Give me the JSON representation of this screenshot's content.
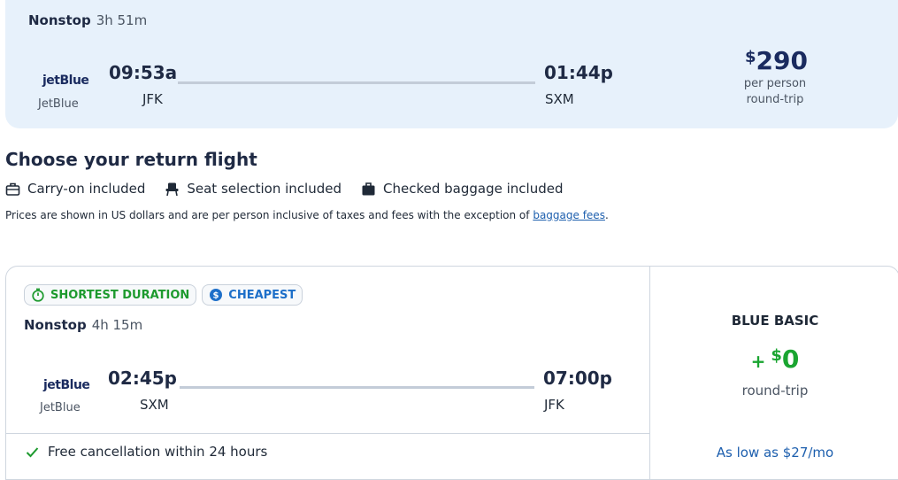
{
  "outbound": {
    "stops": "Nonstop",
    "duration": "3h 51m",
    "airline_logo": "jetBlue",
    "airline_name": "JetBlue",
    "depart_time": "09:53a",
    "depart_code": "JFK",
    "arrive_time": "01:44p",
    "arrive_code": "SXM",
    "price_currency": "$",
    "price_amount": "290",
    "price_note1": "per person",
    "price_note2": "round-trip"
  },
  "section": {
    "title": "Choose your return flight",
    "amenities": {
      "carry_on": "Carry-on included",
      "seat": "Seat selection included",
      "checked": "Checked baggage included"
    },
    "disclaimer": "Prices are shown in US dollars and are per person inclusive of taxes and fees with the exception of",
    "disclaimer_link": "baggage fees",
    "disclaimer_end": "."
  },
  "return": {
    "badge_shortest": "SHORTEST DURATION",
    "badge_cheapest": "CHEAPEST",
    "stops": "Nonstop",
    "duration": "4h 15m",
    "airline_logo": "jetBlue",
    "airline_name": "JetBlue",
    "depart_time": "02:45p",
    "depart_code": "SXM",
    "arrive_time": "07:00p",
    "arrive_code": "JFK",
    "free_cancel": "Free cancellation within 24 hours",
    "fare_name": "BLUE BASIC",
    "fare_plus": "+",
    "fare_currency": "$",
    "fare_amount": "0",
    "fare_sub": "round-trip",
    "fare_low": "As low as $27/mo"
  },
  "colors": {
    "brand_navy": "#1a2b5f",
    "green": "#1aa531",
    "blue_link": "#1d5fae",
    "card_bg": "#e7f1fb"
  }
}
